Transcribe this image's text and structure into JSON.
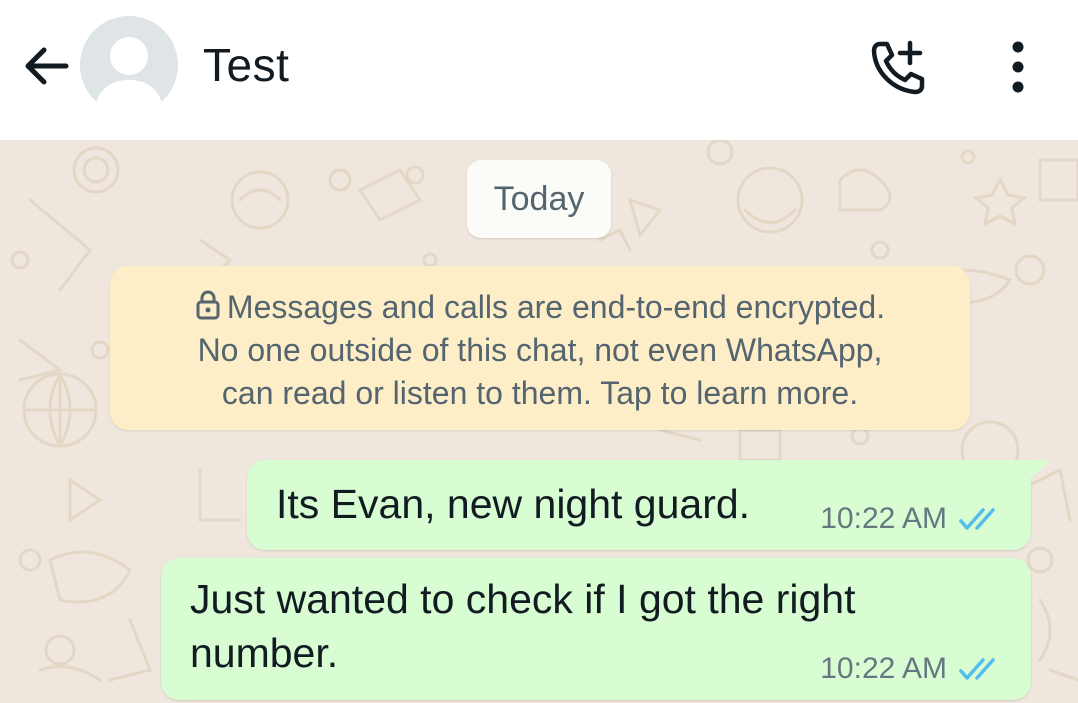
{
  "header": {
    "contact_name": "Test",
    "icons": {
      "back": "arrow-left-icon",
      "avatar": "default-avatar-icon",
      "call": "add-call-icon",
      "menu": "more-vert-icon"
    }
  },
  "chat": {
    "date_chip": "Today",
    "encryption_notice": {
      "lines": [
        "Messages and calls are end-to-end encrypted.",
        "No one outside of this chat, not even WhatsApp,",
        "can read or listen to them. Tap to learn more."
      ],
      "icon": "lock-icon"
    },
    "messages": [
      {
        "text": "Its Evan, new night guard.",
        "time": "10:22 AM",
        "status": "read"
      },
      {
        "text": "Just wanted to check if I got the right number.",
        "time": "10:22 AM",
        "status": "read"
      }
    ]
  },
  "colors": {
    "header_bg": "#ffffff",
    "chat_bg": "#efe7dd",
    "outgoing_bubble": "#d9fdd3",
    "notice_bg": "#fdeec8",
    "read_tick": "#53bdeb",
    "meta_text": "#667781"
  }
}
